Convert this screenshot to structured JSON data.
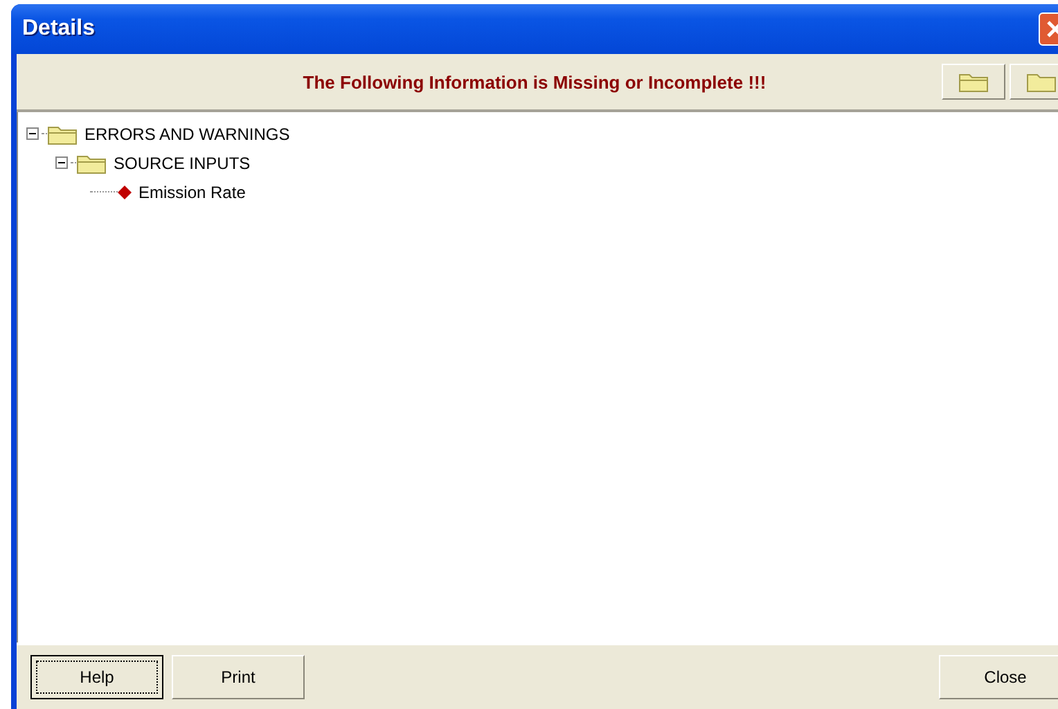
{
  "window": {
    "title": "Details"
  },
  "header": {
    "message": "The Following Information is Missing or Incomplete !!!"
  },
  "tree": [
    {
      "label": "ERRORS AND WARNINGS",
      "kind": "folder",
      "expanded": true,
      "children": [
        {
          "label": "SOURCE INPUTS",
          "kind": "folder",
          "expanded": true,
          "children": [
            {
              "label": "Emission Rate",
              "kind": "item"
            }
          ]
        }
      ]
    }
  ],
  "buttons": [
    {
      "label": "Help",
      "focused": true
    },
    {
      "label": "Print",
      "focused": false
    },
    {
      "label": "Close",
      "focused": false
    }
  ]
}
